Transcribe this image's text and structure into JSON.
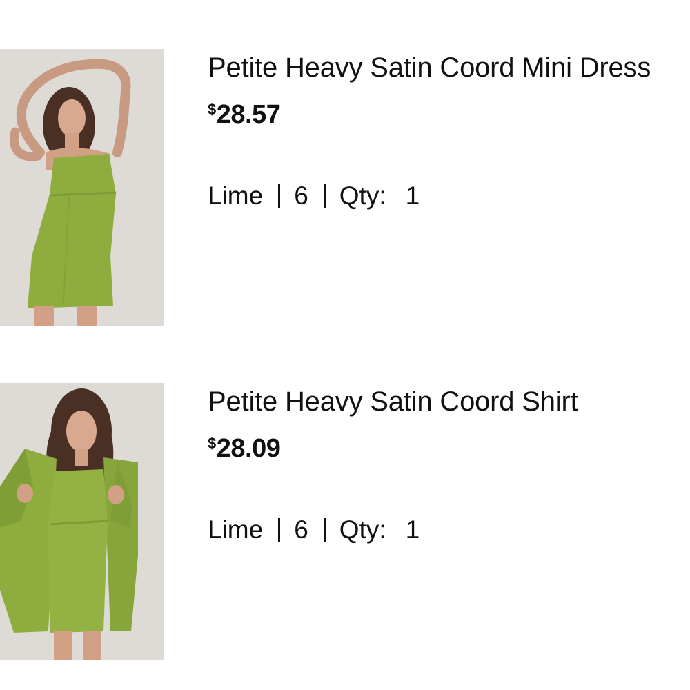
{
  "items": [
    {
      "title": "Petite Heavy Satin Coord Mini Dress",
      "currency": "$",
      "price": "28.57",
      "color": "Lime",
      "size": "6",
      "qty_label": "Qty:",
      "qty": "1",
      "image_icon": "product-photo-mini-dress"
    },
    {
      "title": "Petite Heavy Satin Coord Shirt",
      "currency": "$",
      "price": "28.09",
      "color": "Lime",
      "size": "6",
      "qty_label": "Qty:",
      "qty": "1",
      "image_icon": "product-photo-shirt"
    }
  ],
  "colors": {
    "garment": "#8fad3f",
    "backdrop": "#dedbd6",
    "text": "#111111"
  }
}
